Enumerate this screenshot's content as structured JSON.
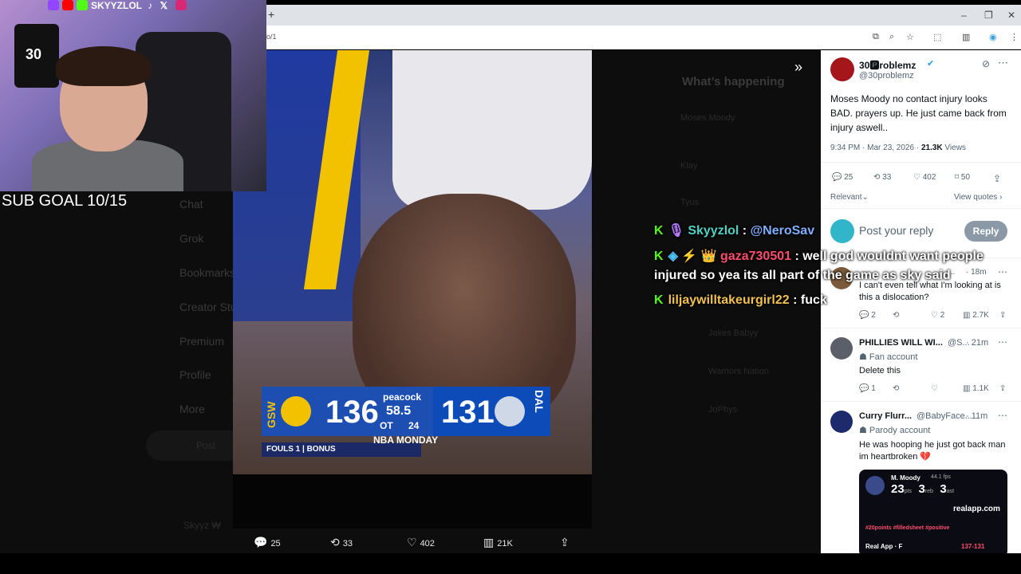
{
  "browser": {
    "new_tab": "+",
    "url": "o/1",
    "min": "–",
    "max": "❐",
    "close": "✕"
  },
  "backdrop": {
    "heading": "What’s happening",
    "trend1": "Moses Moody",
    "trend2": "Klay",
    "trend3": "Tyus",
    "nav": [
      "Chat",
      "Grok",
      "Bookmarks",
      "Creator Studio",
      "Premium",
      "Profile",
      "More"
    ],
    "post_label": "Post",
    "account": "Skyyz ₩",
    "side_names": [
      "Jakes Babyy",
      "Warriors Nation",
      "JoPhys"
    ]
  },
  "scoreboard": {
    "home_team": "GSW",
    "home_score": "136",
    "away_team": "DAL",
    "away_score": "131",
    "network": "peacock",
    "clock": "58.5",
    "period": "OT",
    "shot_clock": "24",
    "fouls": "FOULS 1 | BONUS",
    "show": "NBA MONDAY"
  },
  "media_actions": {
    "replies": "25",
    "reposts": "33",
    "likes": "402",
    "views": "21K"
  },
  "tweet": {
    "name": "30🅿roblemz",
    "handle": "@30problemz",
    "text": "Moses Moody no contact injury looks BAD. prayers up. He just came back from injury aswell..",
    "time": "9:34 PM · Mar 23, 2026 · ",
    "views": "21.3K",
    "views_label": " Views",
    "replies": "25",
    "reposts": "33",
    "likes": "402",
    "bookmarks": "50",
    "sort": "Relevant",
    "view_quotes": "View quotes"
  },
  "composer": {
    "placeholder": "Post your reply",
    "reply_button": "Reply"
  },
  "replies": [
    {
      "name": "",
      "handle": "...",
      "time": "· 18m",
      "text": "I can't even tell what I'm looking at is this a dislocation?",
      "reply_count": "2",
      "like_count": "2",
      "views": "2.7K"
    },
    {
      "name": "PHILLIES WILL WI...",
      "handle": "@S...",
      "time": "· 21m",
      "badge": "Fan account",
      "text": "Delete this",
      "reply_count": "1",
      "like_count": "",
      "views": "1.1K"
    },
    {
      "name": "Curry Flurr...",
      "handle": "@BabyFace...",
      "time": "· 11m",
      "badge": "Parody account",
      "text": "He was hooping he just got back man im heartbroken 💔",
      "card": {
        "player": "M. Moody",
        "fps": "44.1 fps",
        "pts": "23",
        "pts_label": "pts",
        "reb": "3",
        "reb_label": "reb",
        "ast": "3",
        "ast_label": "ast",
        "site": "realapp.com",
        "tags": "#20points  #filledsheet  #positive",
        "footer": "Real App · F",
        "score": "137-131"
      }
    }
  ],
  "stream": {
    "username": "SKYYZLOL",
    "sub_goal": "SUB GOAL 10/15",
    "jersey_number": "30"
  },
  "chat": [
    {
      "user": "Skyyzlol",
      "user_color": "#4fd1c5",
      "msg": "@NeroSav",
      "msg_color": "#7fb0ff"
    },
    {
      "user": "gaza730501",
      "user_color": "#ff4d6d",
      "msg": "well god wouldnt want people",
      "msg_color": "#ffffff"
    },
    {
      "user": "",
      "user_color": "#ffffff",
      "msg": "injured so yea its all part of the game as sky said",
      "msg_color": "#ffffff"
    },
    {
      "user": "liljaywilltakeurgirl22",
      "user_color": "#f2c14e",
      "msg": "fuck",
      "msg_color": "#ffffff"
    }
  ]
}
